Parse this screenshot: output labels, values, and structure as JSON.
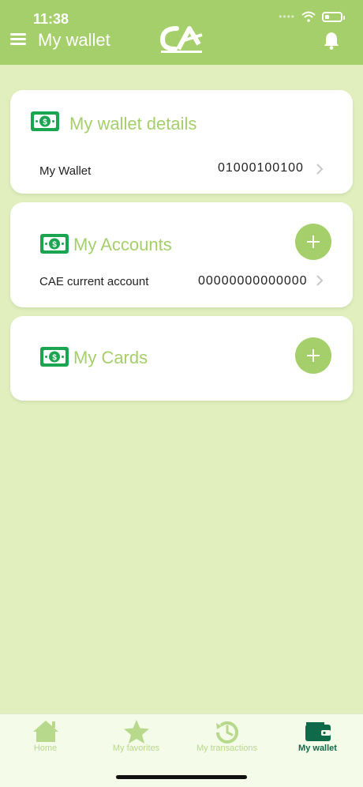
{
  "status": {
    "time": "11:38"
  },
  "header": {
    "title": "My wallet"
  },
  "wallet_details": {
    "title": "My wallet details",
    "row_label": "My Wallet",
    "row_value": "01000100100"
  },
  "accounts": {
    "title": "My Accounts",
    "row_label": "CAE current account",
    "row_value": "00000000000000"
  },
  "cards": {
    "title": "My Cards"
  },
  "tabs": [
    {
      "label": "Home",
      "icon": "home-icon"
    },
    {
      "label": "My favorites",
      "icon": "star-icon"
    },
    {
      "label": "My transactions",
      "icon": "history-icon"
    },
    {
      "label": "My wallet",
      "icon": "wallet-icon",
      "active": true
    }
  ],
  "colors": {
    "accent": "#a5cf6b",
    "background": "#e0efbd",
    "money_icon": "#1aa551",
    "active_tab": "#0f6a49"
  }
}
